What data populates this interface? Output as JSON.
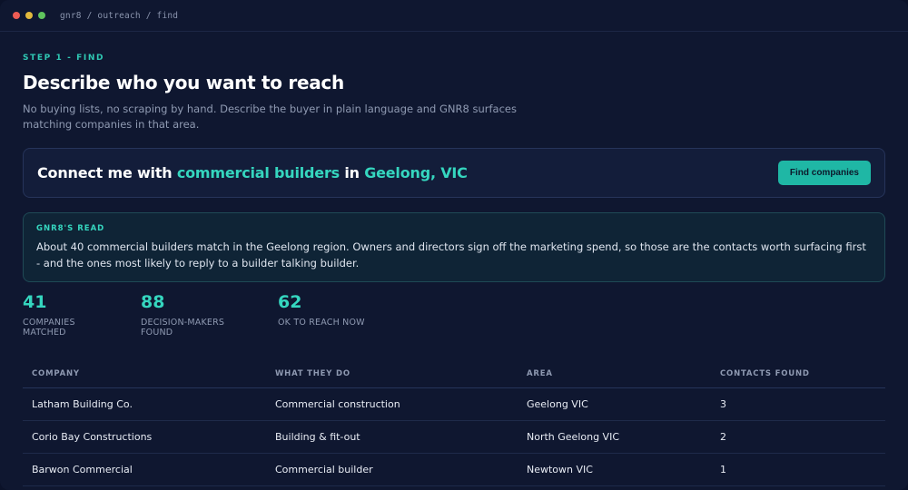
{
  "window": {
    "path": "gnr8 / outreach / find"
  },
  "header": {
    "step": "STEP 1 - FIND",
    "title": "Describe who you want to reach",
    "description": "No buying lists, no scraping by hand. Describe the buyer in plain language and GNR8 surfaces matching companies in that area."
  },
  "query": {
    "prefix": "Connect me with ",
    "audience": "commercial builders",
    "connector": " in ",
    "location": "Geelong, VIC",
    "button_label": "Find companies"
  },
  "read": {
    "label": "GNR8'S READ",
    "text": "About 40 commercial builders match in the Geelong region. Owners and directors sign off the marketing spend, so those are the contacts worth surfacing first - and the ones most likely to reply to a builder talking builder."
  },
  "stats": [
    {
      "value": "41",
      "label": "COMPANIES MATCHED"
    },
    {
      "value": "88",
      "label": "DECISION-MAKERS FOUND"
    },
    {
      "value": "62",
      "label": "OK TO REACH NOW"
    }
  ],
  "table": {
    "headers": [
      "COMPANY",
      "WHAT THEY DO",
      "AREA",
      "CONTACTS FOUND"
    ],
    "rows": [
      [
        "Latham Building Co.",
        "Commercial construction",
        "Geelong VIC",
        "3"
      ],
      [
        "Corio Bay Constructions",
        "Building & fit-out",
        "North Geelong VIC",
        "2"
      ],
      [
        "Barwon Commercial",
        "Commercial builder",
        "Newtown VIC",
        "1"
      ]
    ]
  },
  "colors": {
    "accent": "#35d6bf",
    "background": "#0f1730",
    "button": "#1fb7a5"
  }
}
